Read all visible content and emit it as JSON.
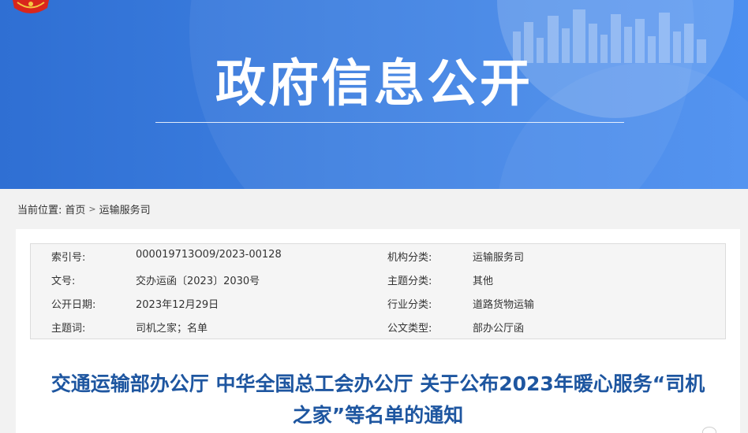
{
  "banner": {
    "title": "政府信息公开",
    "colors": {
      "primary": "#2f6fd3",
      "light": "#4b8ff0"
    },
    "emblem_icon": "national-emblem-icon"
  },
  "breadcrumb": {
    "label": "当前位置:",
    "items": [
      "首页",
      "运输服务司"
    ],
    "separator": ">"
  },
  "meta": {
    "rows": [
      {
        "l1": "索引号:",
        "v1": "000019713O09/2023-00128",
        "l2": "机构分类:",
        "v2": "运输服务司"
      },
      {
        "l1": "文号:",
        "v1": "交办运函〔2023〕2030号",
        "l2": "主题分类:",
        "v2": "其他"
      },
      {
        "l1": "公开日期:",
        "v1": "2023年12月29日",
        "l2": "行业分类:",
        "v2": "道路货物运输"
      },
      {
        "l1": "主题词:",
        "v1": "司机之家；名单",
        "l2": "公文类型:",
        "v2": "部办公厅函"
      }
    ]
  },
  "document": {
    "title_line1": "交通运输部办公厅 中华全国总工会办公厅 关于公布2023年暖心服务“司机",
    "title_line2": "之家”等名单的通知",
    "title_color": "#1e56a0"
  }
}
